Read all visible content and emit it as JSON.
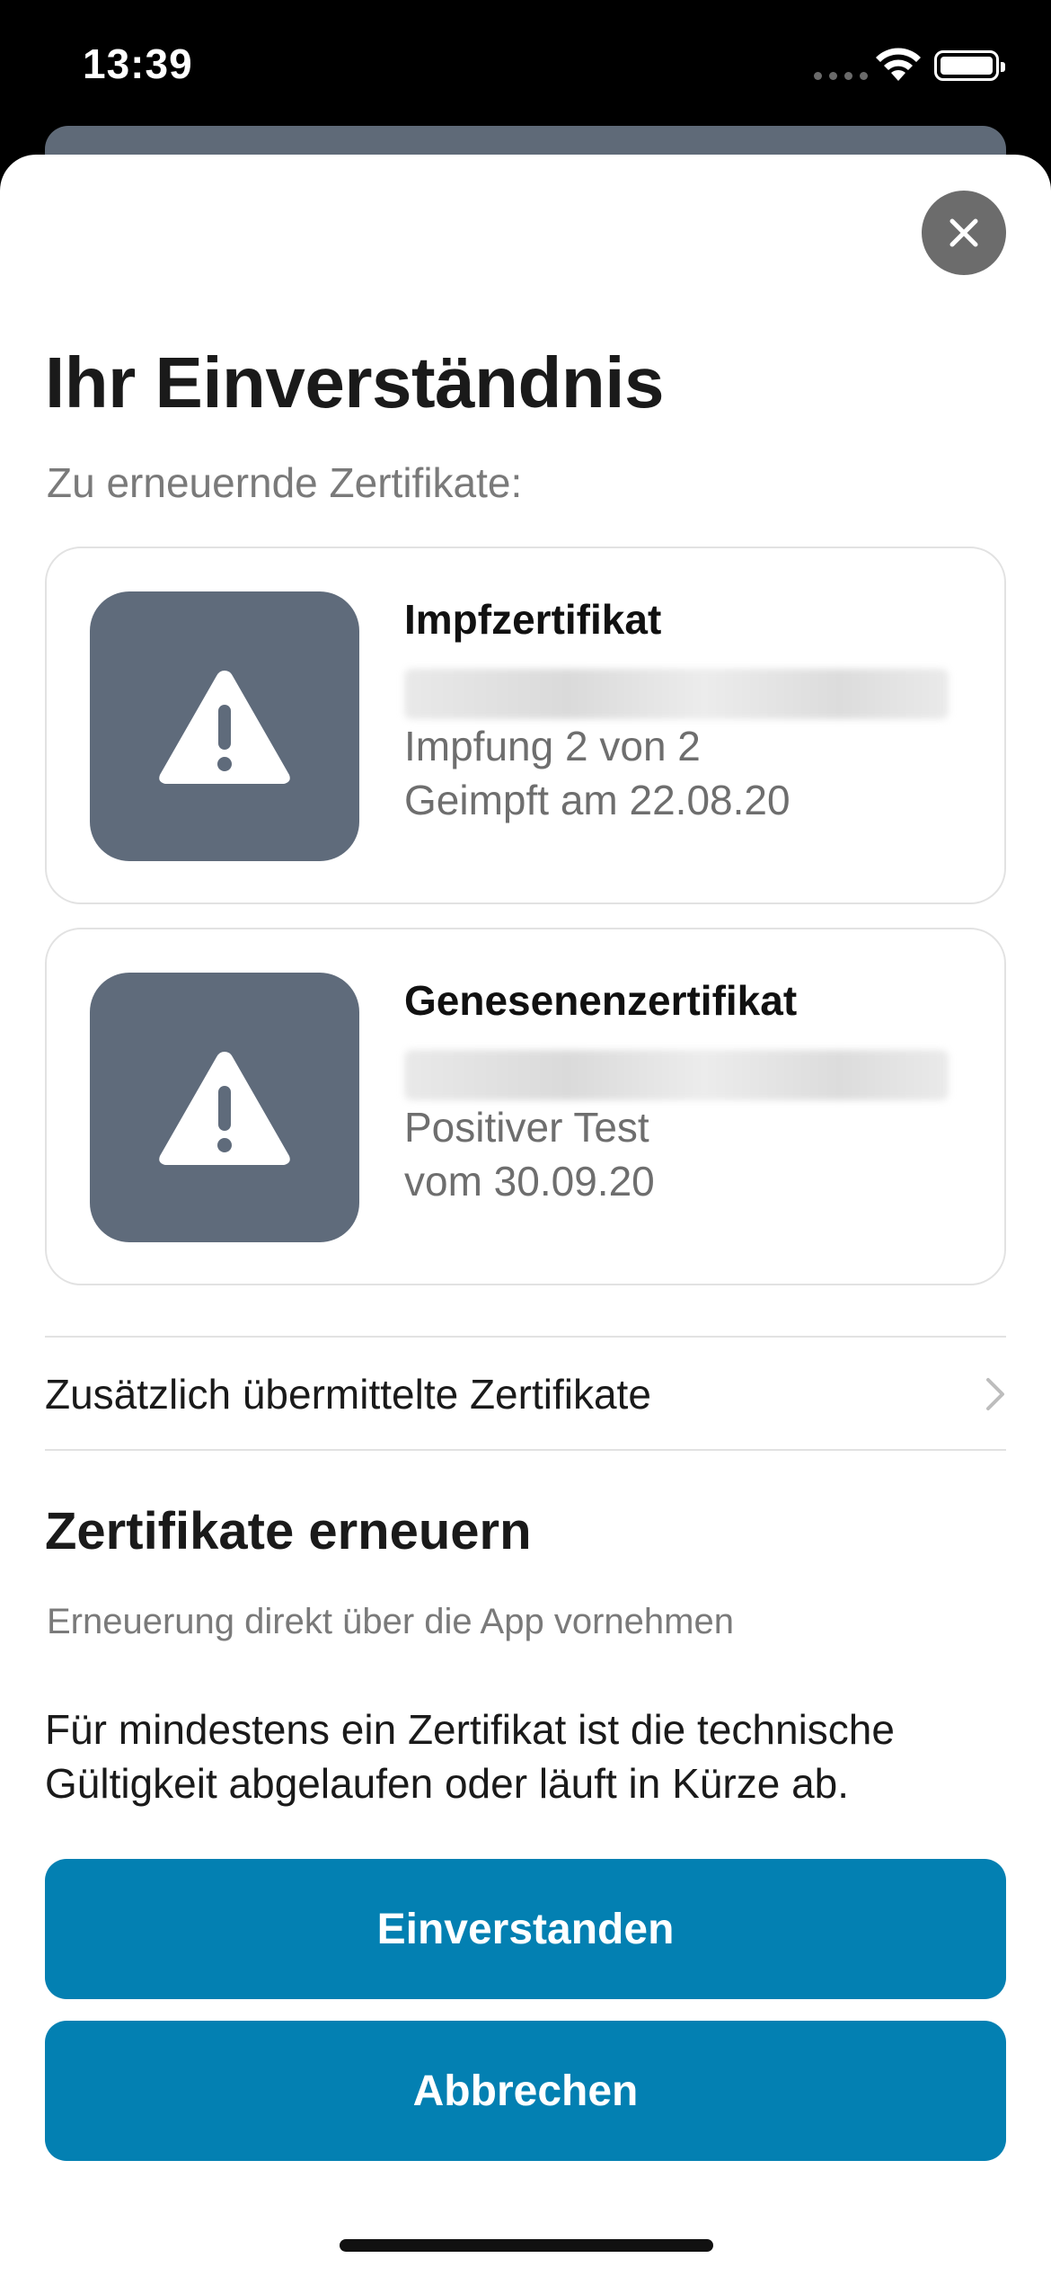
{
  "status_bar": {
    "time": "13:39"
  },
  "sheet": {
    "title": "Ihr Einverständnis",
    "subtitle": "Zu erneuernde Zertifikate:",
    "certificates": [
      {
        "title": "Impfzertifikat",
        "line1": "Impfung 2 von 2",
        "line2": "Geimpft am 22.08.20",
        "icon": "warning-icon"
      },
      {
        "title": "Genesenenzertifikat",
        "line1": "Positiver Test",
        "line2": "vom 30.09.20",
        "icon": "warning-icon"
      }
    ],
    "additional_link": "Zusätzlich übermittelte Zertifikate",
    "section_title": "Zertifikate erneuern",
    "section_subtitle": "Erneuerung direkt über die App vornehmen",
    "body": "Für mindestens ein Zertifikat ist die technische Gültigkeit abgelaufen oder läuft in Kürze ab.",
    "primary_button": "Einverstanden",
    "secondary_button": "Abbrechen"
  },
  "colors": {
    "accent": "#0380b2",
    "thumb": "#5f6b7b",
    "close": "#6c6c6c"
  }
}
